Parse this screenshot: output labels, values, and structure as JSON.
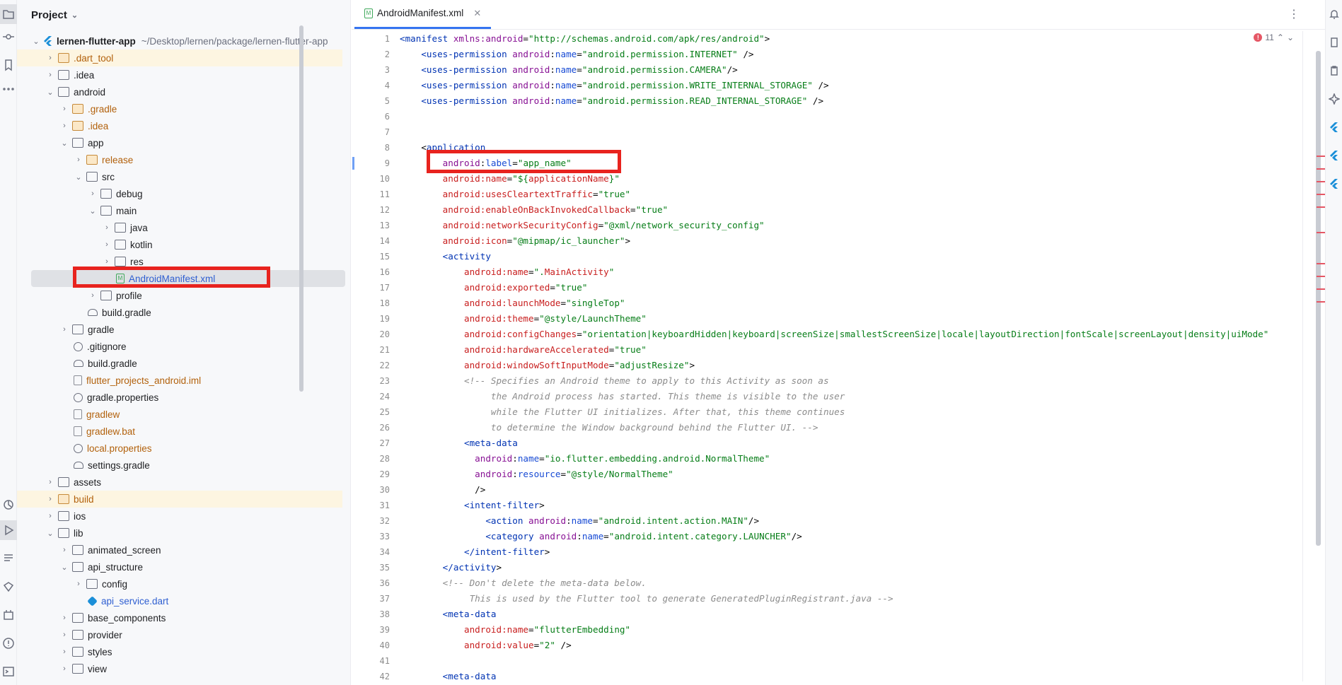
{
  "project_panel": {
    "title": "Project",
    "root": {
      "name": "lernen-flutter-app",
      "path": "~/Desktop/lernen/package/lernen-flutter-app"
    },
    "items": [
      {
        "name": ".dart_tool",
        "type": "folder",
        "color": "orange",
        "arrow": "›",
        "indent": 1,
        "highlight": true
      },
      {
        "name": ".idea",
        "type": "folder",
        "arrow": "›",
        "indent": 1
      },
      {
        "name": "android",
        "type": "folder",
        "arrow": "⌄",
        "indent": 1
      },
      {
        "name": ".gradle",
        "type": "folder",
        "color": "orange",
        "arrow": "›",
        "indent": 2
      },
      {
        "name": ".idea",
        "type": "folder",
        "color": "orange",
        "arrow": "›",
        "indent": 2
      },
      {
        "name": "app",
        "type": "folder",
        "arrow": "⌄",
        "indent": 2
      },
      {
        "name": "release",
        "type": "folder",
        "color": "orange",
        "arrow": "›",
        "indent": 3
      },
      {
        "name": "src",
        "type": "folder",
        "arrow": "⌄",
        "indent": 3
      },
      {
        "name": "debug",
        "type": "folder",
        "arrow": "›",
        "indent": 4
      },
      {
        "name": "main",
        "type": "folder",
        "arrow": "⌄",
        "indent": 4
      },
      {
        "name": "java",
        "type": "folder",
        "arrow": "›",
        "indent": 5
      },
      {
        "name": "kotlin",
        "type": "folder",
        "arrow": "›",
        "indent": 5
      },
      {
        "name": "res",
        "type": "folder",
        "arrow": "›",
        "indent": 5
      },
      {
        "name": "AndroidManifest.xml",
        "type": "xml",
        "indent": 5,
        "selected": true
      },
      {
        "name": "profile",
        "type": "folder",
        "arrow": "›",
        "indent": 4
      },
      {
        "name": "build.gradle",
        "type": "elephant",
        "indent": 3
      },
      {
        "name": "gradle",
        "type": "folder",
        "arrow": "›",
        "indent": 2
      },
      {
        "name": ".gitignore",
        "type": "ban",
        "indent": 2
      },
      {
        "name": "build.gradle",
        "type": "elephant",
        "indent": 2
      },
      {
        "name": "flutter_projects_android.iml",
        "type": "file",
        "color": "orange",
        "indent": 2
      },
      {
        "name": "gradle.properties",
        "type": "gear",
        "indent": 2
      },
      {
        "name": "gradlew",
        "type": "file",
        "color": "orange",
        "indent": 2
      },
      {
        "name": "gradlew.bat",
        "type": "file",
        "color": "orange",
        "indent": 2
      },
      {
        "name": "local.properties",
        "type": "gear",
        "color": "orange",
        "indent": 2
      },
      {
        "name": "settings.gradle",
        "type": "elephant",
        "indent": 2
      },
      {
        "name": "assets",
        "type": "folder",
        "arrow": "›",
        "indent": 1
      },
      {
        "name": "build",
        "type": "folder",
        "color": "orange",
        "arrow": "›",
        "indent": 1,
        "highlight": true
      },
      {
        "name": "ios",
        "type": "folder",
        "arrow": "›",
        "indent": 1
      },
      {
        "name": "lib",
        "type": "folder",
        "arrow": "⌄",
        "indent": 1
      },
      {
        "name": "animated_screen",
        "type": "folder",
        "arrow": "›",
        "indent": 2
      },
      {
        "name": "api_structure",
        "type": "folder",
        "arrow": "⌄",
        "indent": 2
      },
      {
        "name": "config",
        "type": "folder",
        "arrow": "›",
        "indent": 3
      },
      {
        "name": "api_service.dart",
        "type": "dart",
        "color": "blue",
        "indent": 3
      },
      {
        "name": "base_components",
        "type": "folder",
        "arrow": "›",
        "indent": 2
      },
      {
        "name": "provider",
        "type": "folder",
        "arrow": "›",
        "indent": 2
      },
      {
        "name": "styles",
        "type": "folder",
        "arrow": "›",
        "indent": 2
      },
      {
        "name": "view",
        "type": "folder",
        "arrow": "›",
        "indent": 2
      }
    ]
  },
  "editor": {
    "tab_label": "AndroidManifest.xml",
    "error_count": "11",
    "line_numbers": [
      "1",
      "2",
      "3",
      "4",
      "5",
      "6",
      "7",
      "8",
      "9",
      "10",
      "11",
      "12",
      "13",
      "14",
      "15",
      "16",
      "17",
      "18",
      "19",
      "20",
      "21",
      "22",
      "23",
      "24",
      "25",
      "26",
      "27",
      "28",
      "29",
      "30",
      "31",
      "32",
      "33",
      "34",
      "35",
      "36",
      "37",
      "38",
      "39",
      "40",
      "41",
      "42"
    ],
    "lines": [
      [
        [
          "t",
          "<manifest "
        ],
        [
          "ns",
          "xmlns:android"
        ],
        [
          "",
          "="
        ],
        [
          "v",
          "\"http://schemas.android.com/apk/res/android\""
        ],
        [
          "",
          ">"
        ]
      ],
      [
        [
          "",
          "    "
        ],
        [
          "t",
          "<uses-permission "
        ],
        [
          "ns",
          "android"
        ],
        [
          "",
          ":"
        ],
        [
          "at",
          "name"
        ],
        [
          "",
          "="
        ],
        [
          "v",
          "\"android.permission.INTERNET\""
        ],
        [
          "",
          " />"
        ]
      ],
      [
        [
          "",
          "    "
        ],
        [
          "t",
          "<uses-permission "
        ],
        [
          "ns",
          "android"
        ],
        [
          "",
          ":"
        ],
        [
          "at",
          "name"
        ],
        [
          "",
          "="
        ],
        [
          "v",
          "\"android.permission.CAMERA\""
        ],
        [
          "",
          "/>"
        ]
      ],
      [
        [
          "",
          "    "
        ],
        [
          "t",
          "<uses-permission "
        ],
        [
          "ns",
          "android"
        ],
        [
          "",
          ":"
        ],
        [
          "at",
          "name"
        ],
        [
          "",
          "="
        ],
        [
          "v",
          "\"android.permission.WRITE_INTERNAL_STORAGE\""
        ],
        [
          "",
          " />"
        ]
      ],
      [
        [
          "",
          "    "
        ],
        [
          "t",
          "<uses-permission "
        ],
        [
          "ns",
          "android"
        ],
        [
          "",
          ":"
        ],
        [
          "at",
          "name"
        ],
        [
          "",
          "="
        ],
        [
          "v",
          "\"android.permission.READ_INTERNAL_STORAGE\""
        ],
        [
          "",
          " />"
        ]
      ],
      [],
      [],
      [
        [
          "",
          "    <"
        ],
        [
          "t",
          "application"
        ]
      ],
      [
        [
          "",
          "        "
        ],
        [
          "ns",
          "android"
        ],
        [
          "",
          ":"
        ],
        [
          "at",
          "label"
        ],
        [
          "",
          "="
        ],
        [
          "v",
          "\"app_name\""
        ]
      ],
      [
        [
          "",
          "        "
        ],
        [
          "an",
          "android:name"
        ],
        [
          "",
          "="
        ],
        [
          "v",
          "\"${"
        ],
        [
          "an",
          "applicationName"
        ],
        [
          "v",
          "}\""
        ]
      ],
      [
        [
          "",
          "        "
        ],
        [
          "an",
          "android:usesCleartextTraffic"
        ],
        [
          "",
          "="
        ],
        [
          "v",
          "\"true\""
        ]
      ],
      [
        [
          "",
          "        "
        ],
        [
          "an",
          "android:enableOnBackInvokedCallback"
        ],
        [
          "",
          "="
        ],
        [
          "v",
          "\"true\""
        ]
      ],
      [
        [
          "",
          "        "
        ],
        [
          "an",
          "android:networkSecurityConfig"
        ],
        [
          "",
          "="
        ],
        [
          "v",
          "\"@xml/network_security_config\""
        ]
      ],
      [
        [
          "",
          "        "
        ],
        [
          "an",
          "android:icon"
        ],
        [
          "",
          "="
        ],
        [
          "v",
          "\"@mipmap/ic_launcher\""
        ],
        [
          "",
          ">"
        ]
      ],
      [
        [
          "",
          "        "
        ],
        [
          "t",
          "<activity"
        ]
      ],
      [
        [
          "",
          "            "
        ],
        [
          "an",
          "android:name"
        ],
        [
          "",
          "="
        ],
        [
          "v",
          "\"."
        ],
        [
          "an",
          "MainActivity"
        ],
        [
          "v",
          "\""
        ]
      ],
      [
        [
          "",
          "            "
        ],
        [
          "an",
          "android:exported"
        ],
        [
          "",
          "="
        ],
        [
          "v",
          "\"true\""
        ]
      ],
      [
        [
          "",
          "            "
        ],
        [
          "an",
          "android:launchMode"
        ],
        [
          "",
          "="
        ],
        [
          "v",
          "\"singleTop\""
        ]
      ],
      [
        [
          "",
          "            "
        ],
        [
          "an",
          "android:theme"
        ],
        [
          "",
          "="
        ],
        [
          "v",
          "\"@style/LaunchTheme\""
        ]
      ],
      [
        [
          "",
          "            "
        ],
        [
          "an",
          "android:configChanges"
        ],
        [
          "",
          "="
        ],
        [
          "v",
          "\"orientation|keyboardHidden|keyboard|screenSize|smallestScreenSize|locale|layoutDirection|fontScale|screenLayout|density|uiMode\""
        ]
      ],
      [
        [
          "",
          "            "
        ],
        [
          "an",
          "android:hardwareAccelerated"
        ],
        [
          "",
          "="
        ],
        [
          "v",
          "\"true\""
        ]
      ],
      [
        [
          "",
          "            "
        ],
        [
          "an",
          "android:windowSoftInputMode"
        ],
        [
          "",
          "="
        ],
        [
          "v",
          "\"adjustResize\""
        ],
        [
          "",
          ">"
        ]
      ],
      [
        [
          "",
          "            "
        ],
        [
          "c",
          "<!-- Specifies an Android theme to apply to this Activity as soon as"
        ]
      ],
      [
        [
          "",
          "                 "
        ],
        [
          "c",
          "the Android process has started. This theme is visible to the user"
        ]
      ],
      [
        [
          "",
          "                 "
        ],
        [
          "c",
          "while the Flutter UI initializes. After that, this theme continues"
        ]
      ],
      [
        [
          "",
          "                 "
        ],
        [
          "c",
          "to determine the Window background behind the Flutter UI. -->"
        ]
      ],
      [
        [
          "",
          "            "
        ],
        [
          "t",
          "<meta-data"
        ]
      ],
      [
        [
          "",
          "              "
        ],
        [
          "ns",
          "android"
        ],
        [
          "",
          ":"
        ],
        [
          "at",
          "name"
        ],
        [
          "",
          "="
        ],
        [
          "v",
          "\"io.flutter.embedding.android.NormalTheme\""
        ]
      ],
      [
        [
          "",
          "              "
        ],
        [
          "ns",
          "android"
        ],
        [
          "",
          ":"
        ],
        [
          "at",
          "resource"
        ],
        [
          "",
          "="
        ],
        [
          "v",
          "\"@style/NormalTheme\""
        ]
      ],
      [
        [
          "",
          "              />"
        ]
      ],
      [
        [
          "",
          "            "
        ],
        [
          "t",
          "<intent-filter"
        ],
        [
          "",
          ">"
        ]
      ],
      [
        [
          "",
          "                "
        ],
        [
          "t",
          "<action "
        ],
        [
          "ns",
          "android"
        ],
        [
          "",
          ":"
        ],
        [
          "at",
          "name"
        ],
        [
          "",
          "="
        ],
        [
          "v",
          "\"android.intent.action.MAIN\""
        ],
        [
          "",
          "/>"
        ]
      ],
      [
        [
          "",
          "                "
        ],
        [
          "t",
          "<category "
        ],
        [
          "ns",
          "android"
        ],
        [
          "",
          ":"
        ],
        [
          "at",
          "name"
        ],
        [
          "",
          "="
        ],
        [
          "v",
          "\"android.intent.category.LAUNCHER\""
        ],
        [
          "",
          "/>"
        ]
      ],
      [
        [
          "",
          "            "
        ],
        [
          "t",
          "</intent-filter"
        ],
        [
          "",
          ">"
        ]
      ],
      [
        [
          "",
          "        "
        ],
        [
          "t",
          "</activity"
        ],
        [
          "",
          ">"
        ]
      ],
      [
        [
          "",
          "        "
        ],
        [
          "c",
          "<!-- Don't delete the meta-data below."
        ]
      ],
      [
        [
          "",
          "             "
        ],
        [
          "c",
          "This is used by the Flutter tool to generate GeneratedPluginRegistrant.java -->"
        ]
      ],
      [
        [
          "",
          "        "
        ],
        [
          "t",
          "<meta-data"
        ]
      ],
      [
        [
          "",
          "            "
        ],
        [
          "an",
          "android:name"
        ],
        [
          "",
          "="
        ],
        [
          "v",
          "\"flutterEmbedding\""
        ]
      ],
      [
        [
          "",
          "            "
        ],
        [
          "an",
          "android:value"
        ],
        [
          "",
          "="
        ],
        [
          "v",
          "\"2\""
        ],
        [
          "",
          " />"
        ]
      ],
      [],
      [
        [
          "",
          "        "
        ],
        [
          "t",
          "<meta-data"
        ]
      ]
    ]
  },
  "colors": {
    "highlight_box": "#e8231e",
    "tab_accent": "#3574f0"
  }
}
